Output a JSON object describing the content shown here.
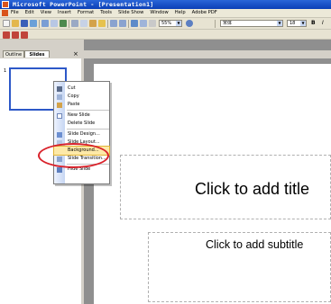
{
  "window": {
    "title": "Microsoft PowerPoint - [Presentation1]"
  },
  "menubar": {
    "items": [
      "File",
      "Edit",
      "View",
      "Insert",
      "Format",
      "Tools",
      "Slide Show",
      "Window",
      "Help",
      "Adobe PDF"
    ]
  },
  "toolbar": {
    "zoom": "55%",
    "font_name": "宋体",
    "font_size": "18",
    "bold_label": "B",
    "italic_label": "I"
  },
  "pane": {
    "tab_outline": "Outline",
    "tab_slides": "Slides",
    "close_glyph": "×",
    "slide_number": "1"
  },
  "context_menu": {
    "items": [
      {
        "label": "Cut",
        "icon": "scissors-icon"
      },
      {
        "label": "Copy",
        "icon": "copy-icon"
      },
      {
        "label": "Paste",
        "icon": "paste-icon"
      },
      {
        "label": "New Slide",
        "icon": "new-slide-icon"
      },
      {
        "label": "Delete Slide",
        "icon": ""
      },
      {
        "label": "Slide Design...",
        "icon": "slide-design-icon"
      },
      {
        "label": "Slide Layout...",
        "icon": "slide-layout-icon"
      },
      {
        "label": "Background...",
        "icon": "background-icon"
      },
      {
        "label": "Slide Transition...",
        "icon": "slide-transition-icon"
      },
      {
        "label": "Hide Slide",
        "icon": "hide-slide-icon"
      }
    ],
    "highlighted_item": "Background..."
  },
  "slide": {
    "title_placeholder": "Click to add title",
    "subtitle_placeholder": "Click to add subtitle"
  },
  "colors": {
    "title_bar": "#0b3fb6",
    "highlight": "#fde9a8",
    "annotation": "#d9212a",
    "thumbnail_border": "#2d58c8"
  }
}
